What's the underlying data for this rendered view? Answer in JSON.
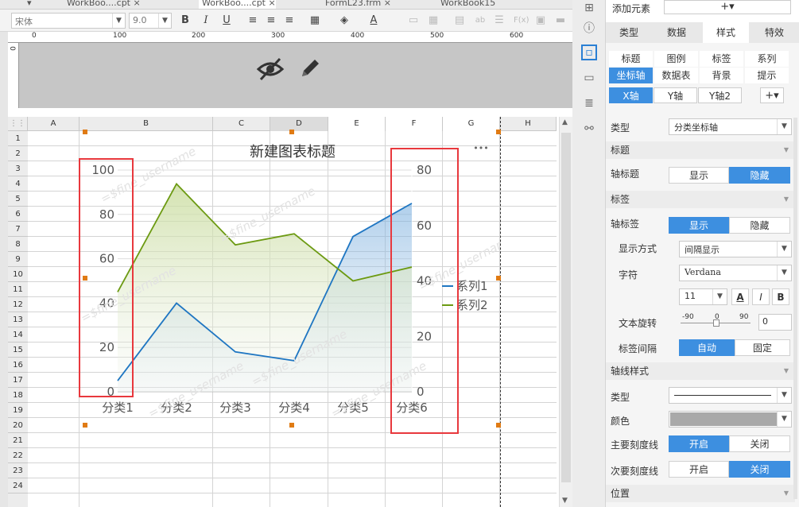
{
  "tabs": [
    {
      "label": "▾"
    },
    {
      "label": "WorkBoo....cpt ×"
    },
    {
      "label": "WorkBoo....cpt ×"
    },
    {
      "label": "FormL23.frm ×"
    },
    {
      "label": "WorkBook15"
    }
  ],
  "format_bar": {
    "font_name": "宋体",
    "font_size": "9.0",
    "bold": "B",
    "italic": "I",
    "underline": "U",
    "font_color_glyph": "A",
    "fx_glyph": "F(x)",
    "ab_glyph": "ab"
  },
  "ruler": {
    "marks": [
      "0",
      "100",
      "200",
      "300",
      "400",
      "500",
      "600"
    ],
    "left_mark": "0"
  },
  "columns": [
    "A",
    "B",
    "C",
    "D",
    "E",
    "F",
    "G",
    "H"
  ],
  "rows": [
    "1",
    "2",
    "3",
    "4",
    "5",
    "6",
    "7",
    "8",
    "9",
    "10",
    "11",
    "12",
    "13",
    "14",
    "15",
    "16",
    "17",
    "18",
    "19",
    "20",
    "21",
    "22",
    "23",
    "24"
  ],
  "chart_data": {
    "type": "line",
    "title": "新建图表标题",
    "categories": [
      "分类1",
      "分类2",
      "分类3",
      "分类4",
      "分类5",
      "分类6"
    ],
    "series": [
      {
        "name": "系列1",
        "axis": "left",
        "values": [
          5,
          40,
          18,
          14,
          70,
          85
        ],
        "color": "#1f76c2"
      },
      {
        "name": "系列2",
        "axis": "right",
        "values": [
          36,
          75,
          53,
          57,
          40,
          45
        ],
        "color": "#6c9a12"
      }
    ],
    "y_left": {
      "ticks": [
        "0",
        "20",
        "40",
        "60",
        "80",
        "100"
      ],
      "range": [
        0,
        100
      ]
    },
    "y_right": {
      "ticks": [
        "0",
        "20",
        "40",
        "60",
        "80"
      ],
      "range": [
        0,
        80
      ]
    },
    "legend": "right",
    "more_icon": "•••",
    "watermark": "=$fine_username"
  },
  "mid_icons": [
    "grid-icon",
    "info-icon",
    "frame-icon",
    "box-icon",
    "stack-icon",
    "link-icon"
  ],
  "panel": {
    "add_element": "添加元素",
    "add_glyph": "+▾",
    "categories": [
      "类型",
      "数据",
      "样式",
      "特效"
    ],
    "subtabs": [
      "标题",
      "图例",
      "标签",
      "系列",
      "坐标轴",
      "数据表",
      "背景",
      "提示"
    ],
    "axis_tabs": [
      "X轴",
      "Y轴",
      "Y轴2"
    ],
    "type_label": "类型",
    "type_value": "分类坐标轴",
    "sec_title": "标题",
    "axis_title_label": "轴标题",
    "show": "显示",
    "hide": "隐藏",
    "sec_label": "标签",
    "axis_label_label": "轴标签",
    "display_mode_label": "显示方式",
    "display_mode_value": "间隔显示",
    "char_label": "字符",
    "char_value": "Verdana",
    "font_size_value": "11",
    "text_rotation_label": "文本旋转",
    "rot_min": "-90",
    "rot_mid": "0",
    "rot_max": "90",
    "rot_value": "0",
    "label_interval_label": "标签间隔",
    "auto": "自动",
    "fixed": "固定",
    "sec_axis_style": "轴线样式",
    "line_type_label": "类型",
    "color_label": "颜色",
    "major_tick_label": "主要刻度线",
    "minor_tick_label": "次要刻度线",
    "on": "开启",
    "off": "关闭",
    "sec_position": "位置"
  }
}
